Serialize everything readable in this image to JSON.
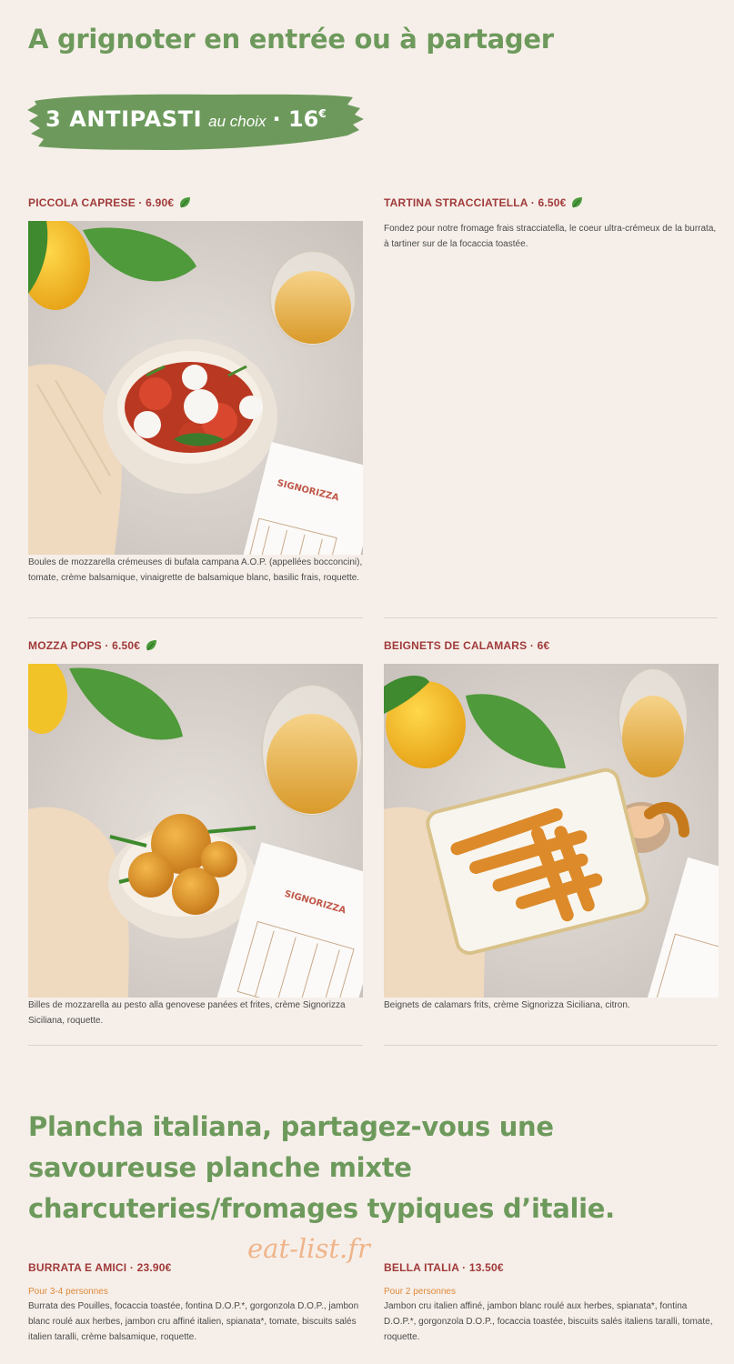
{
  "section1": {
    "title": "A grignoter en entrée ou à partager",
    "banner": {
      "main": "3 ANTIPASTI",
      "italic": "au choix",
      "price": "· 16",
      "currency": "€"
    }
  },
  "items": [
    {
      "name": "PICCOLA CAPRESE · 6.90€",
      "vegetarian": true,
      "description": "Boules de mozzarella crémeuses di bufala campana A.O.P. (appellées bocconcini), tomate, crème balsamique, vinaigrette de balsamique blanc, basilic frais, roquette."
    },
    {
      "name": "TARTINA STRACCIATELLA · 6.50€",
      "vegetarian": true,
      "description": "Fondez pour notre fromage frais stracciatella, le coeur ultra-crémeux de la burrata, à tartiner sur de la focaccia toastée."
    },
    {
      "name": "MOZZA POPS · 6.50€",
      "vegetarian": true,
      "description": "Billes de mozzarella au pesto alla genovese panées et frites, crème Signorizza Siciliana, roquette."
    },
    {
      "name": "BEIGNETS DE CALAMARS · 6€",
      "vegetarian": false,
      "description": "Beignets de calamars frits, crème Signorizza Siciliana, citron."
    }
  ],
  "section2": {
    "title": "Plancha italiana, partagez-vous une savoureuse planche mixte charcuteries/fromages typiques d’italie."
  },
  "planches": [
    {
      "name": "BURRATA E AMICI · 23.90€",
      "serves": "Pour 3-4 personnes",
      "description": "Burrata des Pouilles, focaccia toastée, fontina D.O.P.*, gorgonzola D.O.P., jambon blanc roulé aux herbes, jambon cru affiné italien, spianata*, tomate, biscuits salés italien taralli, crème balsamique, roquette."
    },
    {
      "name": "BELLA ITALIA · 13.50€",
      "serves": "Pour 2 personnes",
      "description": "Jambon cru italien affiné, jambon blanc roulé aux herbes, spianata*, fontina D.O.P.*, gorgonzola D.O.P., focaccia toastée, biscuits salés italiens taralli, tomate, roquette."
    }
  ],
  "napkin_brand": "SIGNORIZZA",
  "watermark": "eat-list.fr",
  "colors": {
    "background": "#f6efe9",
    "title_green": "#6d9a5c",
    "item_red": "#a03a3a",
    "serves_orange": "#e0893a"
  }
}
